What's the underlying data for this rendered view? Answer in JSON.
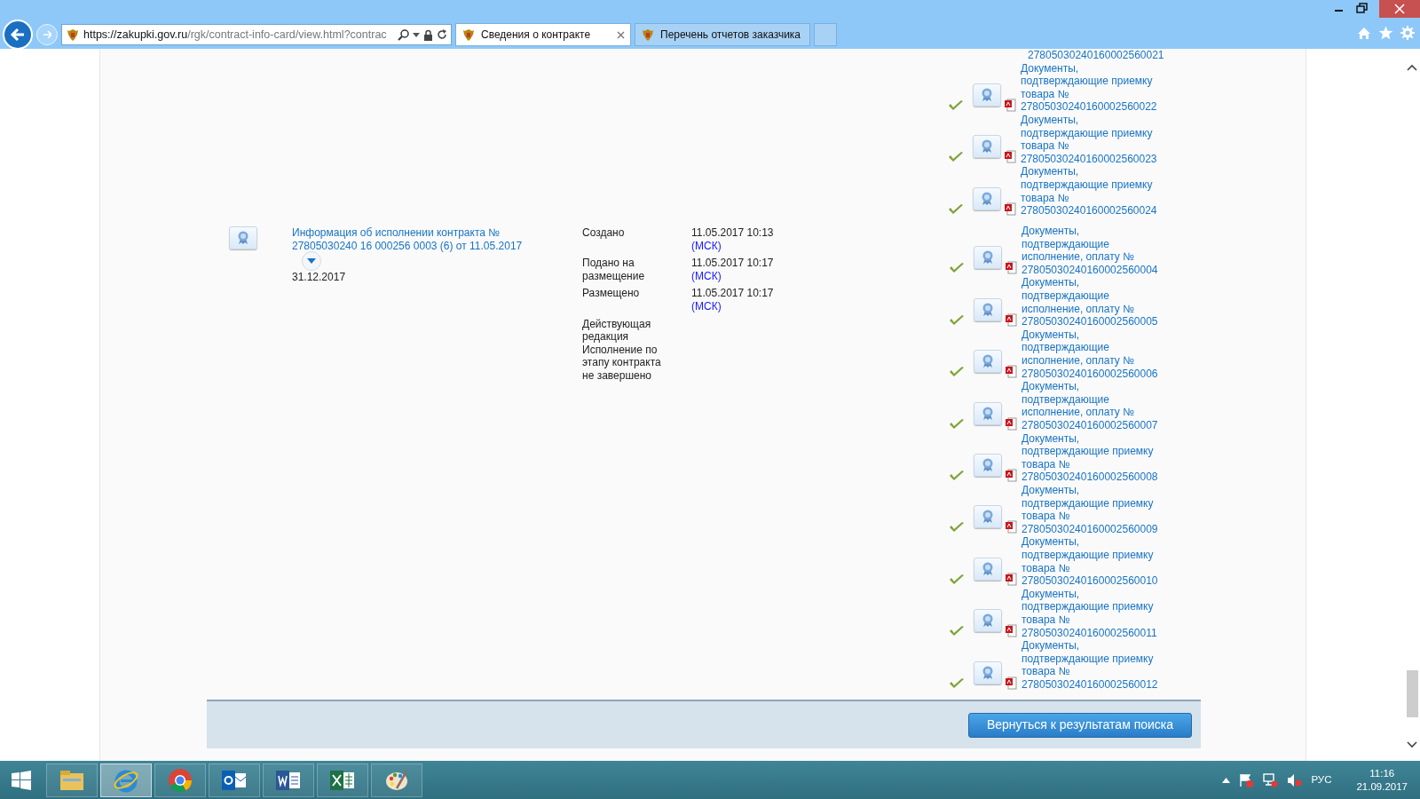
{
  "browser": {
    "address": {
      "host": "https://zakupki.gov.ru",
      "path": "/rgk/contract-info-card/view.html?contrac"
    },
    "tabs": [
      {
        "title": "Сведения о контракте",
        "selected": true
      },
      {
        "title": "Перечень отчетов заказчика",
        "selected": false
      }
    ]
  },
  "documents_above": [
    {
      "text": "27805030240160002560021"
    },
    {
      "text": "Документы, подтверждающие приемку товара № 27805030240160002560022",
      "verified": true
    },
    {
      "text": "Документы, подтверждающие приемку товара № 27805030240160002560023",
      "verified": true
    },
    {
      "text": "Документы, подтверждающие приемку товара № 27805030240160002560024",
      "verified": true
    }
  ],
  "execution": {
    "title_link": "Информация об исполнении контракта № 27805030240 16 000256 0003 (6) от 11.05.2017",
    "date": "31.12.2017",
    "events": [
      {
        "label": "Создано",
        "time": "11.05.2017 10:13",
        "timezone": "(МСК)"
      },
      {
        "label": "Подано на размещение",
        "time": "11.05.2017 10:17",
        "timezone": "(МСК)"
      },
      {
        "label": "Размещено",
        "time": "11.05.2017 10:17",
        "timezone": "(МСК)"
      }
    ],
    "status_lines": [
      "Действующая редакция",
      "Исполнение по этапу контракта не завершено"
    ],
    "documents": [
      {
        "text": "Документы, подтверждающие исполнение, оплату № 27805030240160002560004",
        "verified": true
      },
      {
        "text": "Документы, подтверждающие исполнение, оплату № 27805030240160002560005",
        "verified": true
      },
      {
        "text": "Документы, подтверждающие исполнение, оплату № 27805030240160002560006",
        "verified": true
      },
      {
        "text": "Документы, подтверждающие исполнение, оплату № 27805030240160002560007",
        "verified": true
      },
      {
        "text": "Документы, подтверждающие приемку товара № 27805030240160002560008",
        "verified": true
      },
      {
        "text": "Документы, подтверждающие приемку товара № 27805030240160002560009",
        "verified": true
      },
      {
        "text": "Документы, подтверждающие приемку товара № 27805030240160002560010",
        "verified": true
      },
      {
        "text": "Документы, подтверждающие приемку товара № 27805030240160002560011",
        "verified": true
      },
      {
        "text": "Документы, подтверждающие приемку товара № 27805030240160002560012",
        "verified": true
      }
    ]
  },
  "footer": {
    "back_button": "Вернуться к результатам поиска"
  },
  "taskbar": {
    "apps": [
      {
        "kind": "explorer",
        "selected": false
      },
      {
        "kind": "ie",
        "selected": true
      },
      {
        "kind": "chrome",
        "selected": false
      },
      {
        "kind": "outlook",
        "selected": false
      },
      {
        "kind": "word",
        "selected": false
      },
      {
        "kind": "excel",
        "selected": false
      },
      {
        "kind": "paint",
        "selected": false
      }
    ],
    "language": "РУС",
    "time": "11:16",
    "date": "21.09.2017"
  }
}
